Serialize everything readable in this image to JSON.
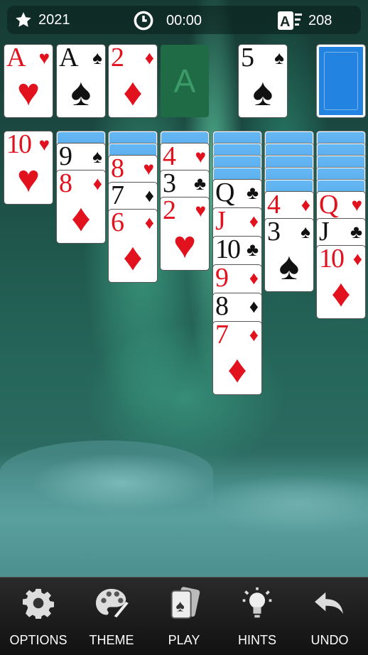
{
  "topbar": {
    "score": "2021",
    "time": "00:00",
    "moves": "208"
  },
  "foundations": [
    {
      "rank": "A",
      "suit": "♥",
      "color": "red"
    },
    {
      "rank": "A",
      "suit": "♠",
      "color": "black"
    },
    {
      "rank": "2",
      "suit": "♦",
      "color": "red"
    },
    {
      "empty": "A"
    }
  ],
  "waste": {
    "rank": "5",
    "suit": "♠",
    "color": "black"
  },
  "tableau": [
    {
      "facedown": 0,
      "cards": [
        {
          "rank": "10",
          "suit": "♥",
          "color": "red"
        }
      ]
    },
    {
      "facedown": 1,
      "cards": [
        {
          "rank": "9",
          "suit": "♠",
          "color": "black"
        },
        {
          "rank": "8",
          "suit": "♦",
          "color": "red"
        }
      ]
    },
    {
      "facedown": 2,
      "cards": [
        {
          "rank": "8",
          "suit": "♥",
          "color": "red"
        },
        {
          "rank": "7",
          "suit": "♦",
          "color": "black"
        },
        {
          "rank": "6",
          "suit": "♦",
          "color": "red"
        }
      ]
    },
    {
      "facedown": 1,
      "cards": [
        {
          "rank": "4",
          "suit": "♥",
          "color": "red"
        },
        {
          "rank": "3",
          "suit": "♣",
          "color": "black"
        },
        {
          "rank": "2",
          "suit": "♥",
          "color": "red"
        }
      ]
    },
    {
      "facedown": 4,
      "cards": [
        {
          "rank": "Q",
          "suit": "♣",
          "color": "black"
        },
        {
          "rank": "J",
          "suit": "♦",
          "color": "red"
        },
        {
          "rank": "10",
          "suit": "♣",
          "color": "black"
        },
        {
          "rank": "9",
          "suit": "♦",
          "color": "red"
        },
        {
          "rank": "8",
          "suit": "♦",
          "color": "black"
        },
        {
          "rank": "7",
          "suit": "♦",
          "color": "red"
        }
      ]
    },
    {
      "facedown": 5,
      "cards": [
        {
          "rank": "4",
          "suit": "♦",
          "color": "red"
        },
        {
          "rank": "3",
          "suit": "♠",
          "color": "black"
        }
      ]
    },
    {
      "facedown": 5,
      "cards": [
        {
          "rank": "Q",
          "suit": "♥",
          "color": "red"
        },
        {
          "rank": "J",
          "suit": "♣",
          "color": "black"
        },
        {
          "rank": "10",
          "suit": "♦",
          "color": "red"
        }
      ]
    }
  ],
  "toolbar": {
    "options": "OPTIONS",
    "theme": "THEME",
    "play": "PLAY",
    "hints": "HINTS",
    "undo": "UNDO"
  }
}
